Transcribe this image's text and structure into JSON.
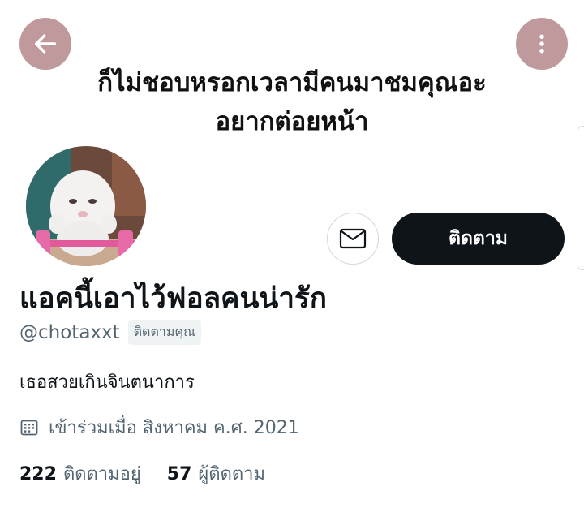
{
  "banner": {
    "line1": "ก็ไม่ชอบหรอกเวลามีคนมาชมคุณอะ",
    "line2": "อยากต่อยหน้า"
  },
  "icons": {
    "back": "arrow-left-icon",
    "more": "more-vertical-icon",
    "message": "envelope-icon",
    "calendar": "calendar-icon"
  },
  "actions": {
    "follow_label": "ติดตาม"
  },
  "profile": {
    "display_name": "แอคนี้เอาไว้ฟอลคนน่ารัก",
    "handle": "@chotaxxt",
    "follows_you": "ติดตามคุณ",
    "bio": "เธอสวยเกินจินตนาการ",
    "joined": "เข้าร่วมเมื่อ สิงหาคม ค.ศ. 2021"
  },
  "stats": {
    "following_count": "222",
    "following_label": "ติดตามอยู่",
    "followers_count": "57",
    "followers_label": "ผู้ติดตาม"
  },
  "colors": {
    "header_button_bg": "#bf999b",
    "primary_button_bg": "#0f1419",
    "secondary_text": "#536471"
  }
}
